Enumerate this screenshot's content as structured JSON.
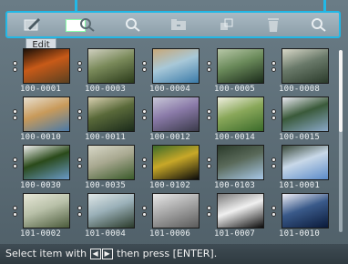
{
  "toolbar": {
    "icons": [
      "pencil-icon",
      "magnify-icon",
      "magnify-icon",
      "folder-icon",
      "copy-icon",
      "trash-icon",
      "search-icon"
    ]
  },
  "edit_label": "Edit",
  "thumbnails": [
    {
      "label": "100-0001",
      "colors": [
        "#5a4020",
        "#c85a18",
        "#1a1008"
      ],
      "selected": false
    },
    {
      "label": "100-0003",
      "colors": [
        "#2a3a1a",
        "#7a8a5a",
        "#d0d0c0"
      ],
      "selected": false
    },
    {
      "label": "100-0004",
      "colors": [
        "#3a7aa8",
        "#a8c8d8",
        "#c8a878"
      ],
      "selected": false
    },
    {
      "label": "100-0005",
      "colors": [
        "#1a2a1a",
        "#6a8a5a",
        "#b8c8a8"
      ],
      "selected": false
    },
    {
      "label": "100-0008",
      "colors": [
        "#2a3a2a",
        "#6a7a6a",
        "#d8d8c8"
      ],
      "selected": false
    },
    {
      "label": "100-0010",
      "colors": [
        "#4a7aa8",
        "#c89a5a",
        "#e8e0d0"
      ],
      "selected": false
    },
    {
      "label": "100-0011",
      "colors": [
        "#1a2a1a",
        "#5a6a3a",
        "#d8d0b0"
      ],
      "selected": false
    },
    {
      "label": "100-0012",
      "colors": [
        "#3a3a4a",
        "#8a7aa8",
        "#c8c8d8"
      ],
      "selected": false
    },
    {
      "label": "100-0014",
      "colors": [
        "#3a6a2a",
        "#8aa85a",
        "#f0f0e0"
      ],
      "selected": false
    },
    {
      "label": "100-0015",
      "colors": [
        "#8aa8c8",
        "#3a5a3a",
        "#e8e8f0"
      ],
      "selected": false
    },
    {
      "label": "100-0030",
      "colors": [
        "#6a9ac8",
        "#2a4a1a",
        "#f0f0f0"
      ],
      "selected": false
    },
    {
      "label": "100-0035",
      "colors": [
        "#3a5a2a",
        "#a8a890",
        "#d8d8c8"
      ],
      "selected": false
    },
    {
      "label": "100-0102",
      "colors": [
        "#0a0a0a",
        "#c8a828",
        "#3a6a2a"
      ],
      "selected": false
    },
    {
      "label": "100-0103",
      "colors": [
        "#a8c8e8",
        "#5a6a5a",
        "#2a3a2a"
      ],
      "selected": false
    },
    {
      "label": "101-0001",
      "colors": [
        "#5a8ac8",
        "#c8d8e8",
        "#3a4a3a"
      ],
      "selected": false
    },
    {
      "label": "101-0002",
      "colors": [
        "#4a5a3a",
        "#b8c0a8",
        "#e8e8d8"
      ],
      "selected": false
    },
    {
      "label": "101-0004",
      "colors": [
        "#2a3a2a",
        "#9ab0b8",
        "#e0e8e8"
      ],
      "selected": false
    },
    {
      "label": "101-0006",
      "colors": [
        "#5a5a5a",
        "#a8a8a8",
        "#e8e8e8"
      ],
      "selected": false
    },
    {
      "label": "101-0007",
      "colors": [
        "#0a0a0a",
        "#f0f0f0",
        "#7a7a7a"
      ],
      "selected": false
    },
    {
      "label": "101-0010",
      "colors": [
        "#0a1a3a",
        "#3a5a8a",
        "#f0f0f8"
      ],
      "selected": false
    }
  ],
  "status": {
    "prefix": "Select item with",
    "left_key": "◀",
    "right_key": "▶",
    "suffix": "then press [ENTER]."
  },
  "accent_color": "#22b8e6"
}
